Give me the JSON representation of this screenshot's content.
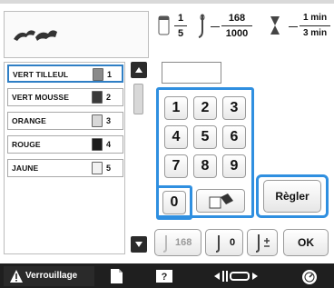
{
  "status": {
    "stitch_fraction": {
      "numerator": "1",
      "denominator": "5"
    },
    "stitch_count": {
      "current": "168",
      "total": "1000"
    },
    "time": {
      "current": "1 min",
      "total": "3 min"
    }
  },
  "thread_list": {
    "items": [
      {
        "name": "VERT TILLEUL",
        "number": "1",
        "color": "#8a8a8a"
      },
      {
        "name": "VERT MOUSSE",
        "number": "2",
        "color": "#3a3a3a"
      },
      {
        "name": "ORANGE",
        "number": "3",
        "color": "#d8d8d8"
      },
      {
        "name": "ROUGE",
        "number": "4",
        "color": "#1c1c1c"
      },
      {
        "name": "JAUNE",
        "number": "5",
        "color": "#f2f2f2"
      }
    ]
  },
  "count_input": {
    "value": ""
  },
  "keypad": {
    "keys": [
      "1",
      "2",
      "3",
      "4",
      "5",
      "6",
      "7",
      "8",
      "9"
    ],
    "zero": "0"
  },
  "buttons": {
    "set_label": "Règler",
    "ok_label": "OK",
    "needle_count_value": "168",
    "needle_zero_value": "0"
  },
  "bottom_bar": {
    "lock_label": "Verrouillage",
    "accent": "#2f8fe0"
  }
}
